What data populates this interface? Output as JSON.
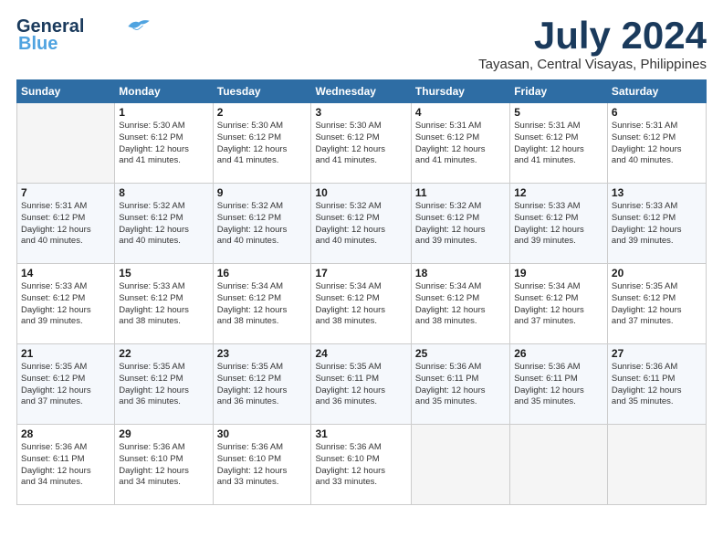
{
  "header": {
    "logo_line1": "General",
    "logo_line2": "Blue",
    "month": "July 2024",
    "location": "Tayasan, Central Visayas, Philippines"
  },
  "days_of_week": [
    "Sunday",
    "Monday",
    "Tuesday",
    "Wednesday",
    "Thursday",
    "Friday",
    "Saturday"
  ],
  "weeks": [
    [
      {
        "day": "",
        "info": ""
      },
      {
        "day": "1",
        "info": "Sunrise: 5:30 AM\nSunset: 6:12 PM\nDaylight: 12 hours\nand 41 minutes."
      },
      {
        "day": "2",
        "info": "Sunrise: 5:30 AM\nSunset: 6:12 PM\nDaylight: 12 hours\nand 41 minutes."
      },
      {
        "day": "3",
        "info": "Sunrise: 5:30 AM\nSunset: 6:12 PM\nDaylight: 12 hours\nand 41 minutes."
      },
      {
        "day": "4",
        "info": "Sunrise: 5:31 AM\nSunset: 6:12 PM\nDaylight: 12 hours\nand 41 minutes."
      },
      {
        "day": "5",
        "info": "Sunrise: 5:31 AM\nSunset: 6:12 PM\nDaylight: 12 hours\nand 41 minutes."
      },
      {
        "day": "6",
        "info": "Sunrise: 5:31 AM\nSunset: 6:12 PM\nDaylight: 12 hours\nand 40 minutes."
      }
    ],
    [
      {
        "day": "7",
        "info": "Sunrise: 5:31 AM\nSunset: 6:12 PM\nDaylight: 12 hours\nand 40 minutes."
      },
      {
        "day": "8",
        "info": "Sunrise: 5:32 AM\nSunset: 6:12 PM\nDaylight: 12 hours\nand 40 minutes."
      },
      {
        "day": "9",
        "info": "Sunrise: 5:32 AM\nSunset: 6:12 PM\nDaylight: 12 hours\nand 40 minutes."
      },
      {
        "day": "10",
        "info": "Sunrise: 5:32 AM\nSunset: 6:12 PM\nDaylight: 12 hours\nand 40 minutes."
      },
      {
        "day": "11",
        "info": "Sunrise: 5:32 AM\nSunset: 6:12 PM\nDaylight: 12 hours\nand 39 minutes."
      },
      {
        "day": "12",
        "info": "Sunrise: 5:33 AM\nSunset: 6:12 PM\nDaylight: 12 hours\nand 39 minutes."
      },
      {
        "day": "13",
        "info": "Sunrise: 5:33 AM\nSunset: 6:12 PM\nDaylight: 12 hours\nand 39 minutes."
      }
    ],
    [
      {
        "day": "14",
        "info": "Sunrise: 5:33 AM\nSunset: 6:12 PM\nDaylight: 12 hours\nand 39 minutes."
      },
      {
        "day": "15",
        "info": "Sunrise: 5:33 AM\nSunset: 6:12 PM\nDaylight: 12 hours\nand 38 minutes."
      },
      {
        "day": "16",
        "info": "Sunrise: 5:34 AM\nSunset: 6:12 PM\nDaylight: 12 hours\nand 38 minutes."
      },
      {
        "day": "17",
        "info": "Sunrise: 5:34 AM\nSunset: 6:12 PM\nDaylight: 12 hours\nand 38 minutes."
      },
      {
        "day": "18",
        "info": "Sunrise: 5:34 AM\nSunset: 6:12 PM\nDaylight: 12 hours\nand 38 minutes."
      },
      {
        "day": "19",
        "info": "Sunrise: 5:34 AM\nSunset: 6:12 PM\nDaylight: 12 hours\nand 37 minutes."
      },
      {
        "day": "20",
        "info": "Sunrise: 5:35 AM\nSunset: 6:12 PM\nDaylight: 12 hours\nand 37 minutes."
      }
    ],
    [
      {
        "day": "21",
        "info": "Sunrise: 5:35 AM\nSunset: 6:12 PM\nDaylight: 12 hours\nand 37 minutes."
      },
      {
        "day": "22",
        "info": "Sunrise: 5:35 AM\nSunset: 6:12 PM\nDaylight: 12 hours\nand 36 minutes."
      },
      {
        "day": "23",
        "info": "Sunrise: 5:35 AM\nSunset: 6:12 PM\nDaylight: 12 hours\nand 36 minutes."
      },
      {
        "day": "24",
        "info": "Sunrise: 5:35 AM\nSunset: 6:11 PM\nDaylight: 12 hours\nand 36 minutes."
      },
      {
        "day": "25",
        "info": "Sunrise: 5:36 AM\nSunset: 6:11 PM\nDaylight: 12 hours\nand 35 minutes."
      },
      {
        "day": "26",
        "info": "Sunrise: 5:36 AM\nSunset: 6:11 PM\nDaylight: 12 hours\nand 35 minutes."
      },
      {
        "day": "27",
        "info": "Sunrise: 5:36 AM\nSunset: 6:11 PM\nDaylight: 12 hours\nand 35 minutes."
      }
    ],
    [
      {
        "day": "28",
        "info": "Sunrise: 5:36 AM\nSunset: 6:11 PM\nDaylight: 12 hours\nand 34 minutes."
      },
      {
        "day": "29",
        "info": "Sunrise: 5:36 AM\nSunset: 6:10 PM\nDaylight: 12 hours\nand 34 minutes."
      },
      {
        "day": "30",
        "info": "Sunrise: 5:36 AM\nSunset: 6:10 PM\nDaylight: 12 hours\nand 33 minutes."
      },
      {
        "day": "31",
        "info": "Sunrise: 5:36 AM\nSunset: 6:10 PM\nDaylight: 12 hours\nand 33 minutes."
      },
      {
        "day": "",
        "info": ""
      },
      {
        "day": "",
        "info": ""
      },
      {
        "day": "",
        "info": ""
      }
    ]
  ]
}
